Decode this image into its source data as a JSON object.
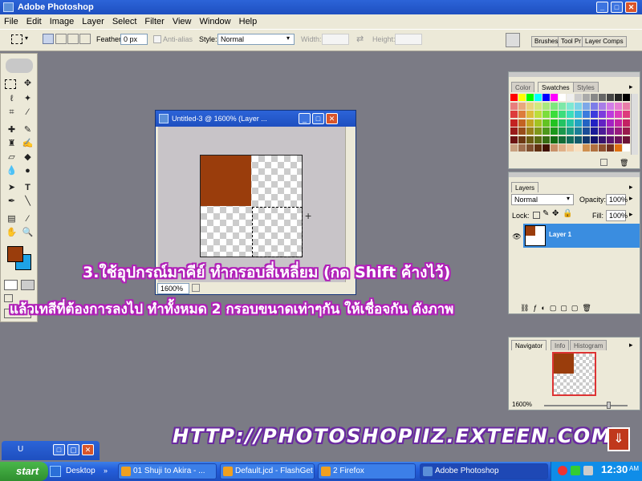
{
  "app": {
    "title": "Adobe Photoshop"
  },
  "menu": [
    "File",
    "Edit",
    "Image",
    "Layer",
    "Select",
    "Filter",
    "View",
    "Window",
    "Help"
  ],
  "options": {
    "feather_label": "Feather:",
    "feather_value": "0 px",
    "antialias_label": "Anti-alias",
    "style_label": "Style:",
    "style_value": "Normal",
    "width_label": "Width:",
    "height_label": "Height:",
    "palette_tabs": [
      "Brushes",
      "Tool Pr",
      "Layer Comps"
    ]
  },
  "document": {
    "title": "Untitled-3 @ 1600% (Layer ...",
    "zoom": "1600%",
    "fill_color": "#9a3d0c"
  },
  "swatches_panel": {
    "tabs": [
      "Color",
      "Swatches",
      "Styles"
    ]
  },
  "layers_panel": {
    "tab": "Layers",
    "blend_mode": "Normal",
    "opacity_label": "Opacity:",
    "opacity_value": "100%",
    "lock_label": "Lock:",
    "fill_label": "Fill:",
    "fill_value": "100%",
    "layer_name": "Layer 1"
  },
  "navigator_panel": {
    "tabs": [
      "Navigator",
      "Info",
      "Histogram"
    ],
    "zoom": "1600%"
  },
  "overlay": {
    "line1": "3.ใช้อุปกรณ์มาคีย์ ทำกรอบสี่เหลี่ยม (กด Shift ค้างไว้)",
    "line2": "แล้วเทสีที่ต้องการลงไป ทำทั้งหมด 2 กรอบขนาดเท่าๆกัน ให้เชื่อจกัน ดังภาพ",
    "url": "HTTP://PHOTOSHOPIIZ.EXTEEN.COM"
  },
  "minimized_window": {
    "label": "U"
  },
  "taskbar": {
    "start": "start",
    "desktop": "Desktop",
    "tasks": [
      "01 Shuji to Akira - ...",
      "Default.jcd - FlashGet",
      "2 Firefox",
      "Adobe Photoshop"
    ],
    "clock": "12:30",
    "tray_text": "AM"
  },
  "colors": {
    "foreground": "#9a3d0c",
    "background": "#1ea3e6",
    "layer_highlight": "#3a8de0"
  }
}
